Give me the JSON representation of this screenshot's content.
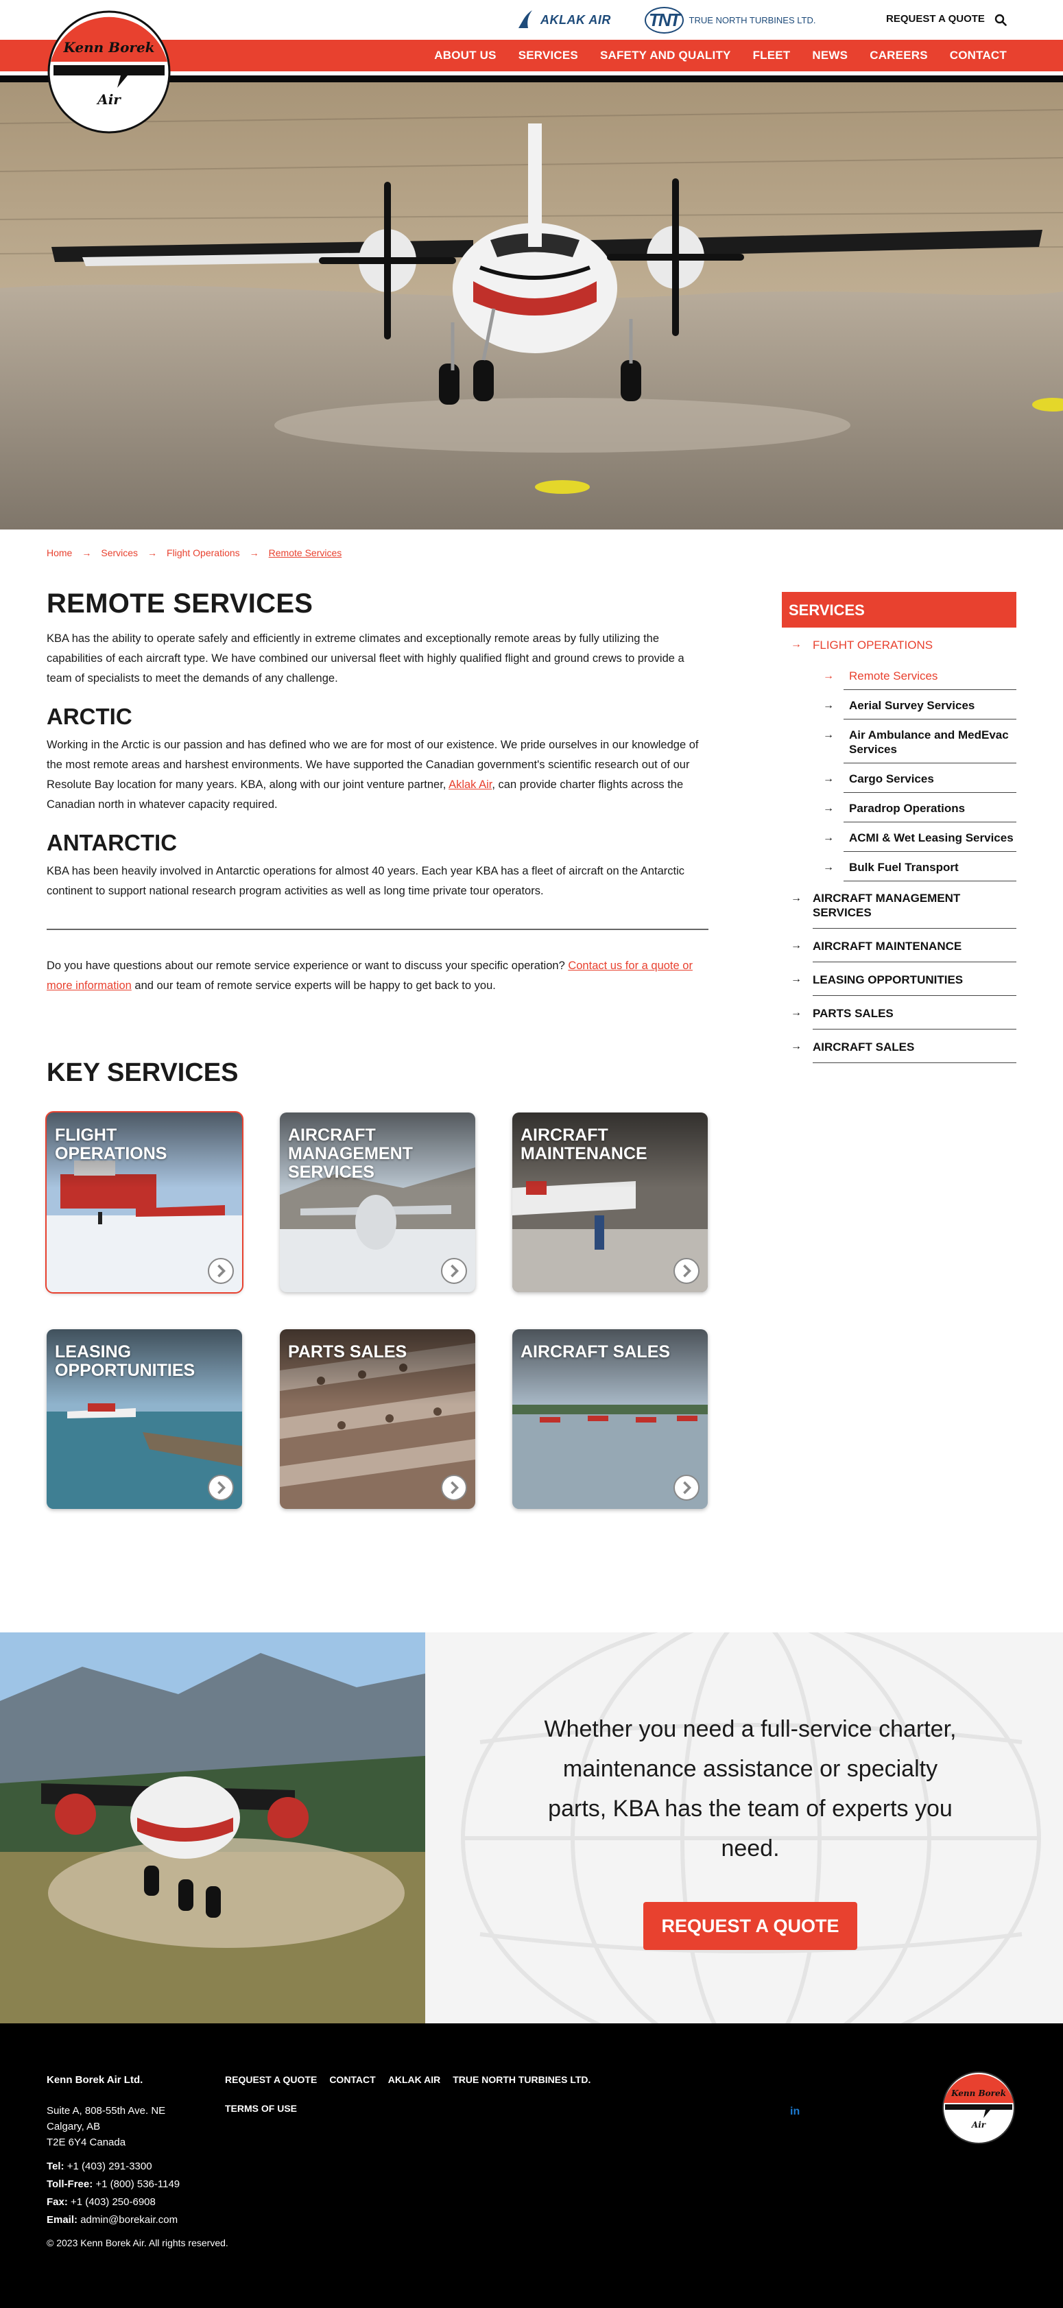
{
  "header": {
    "partners": [
      "AKLAK AIR",
      "TRUE NORTH TURBINES LTD."
    ],
    "request_quote": "REQUEST A QUOTE",
    "search_icon": "search-icon",
    "nav": [
      "ABOUT US",
      "SERVICES",
      "SAFETY AND QUALITY",
      "FLEET",
      "NEWS",
      "CAREERS",
      "CONTACT"
    ],
    "logo_text": [
      "Kenn Borek",
      "Air"
    ]
  },
  "breadcrumb": [
    "Home",
    "Services",
    "Flight Operations",
    "Remote Services"
  ],
  "main": {
    "title": "REMOTE SERVICES",
    "intro": "KBA has the ability to operate safely and efficiently in extreme climates and exceptionally remote areas by fully utilizing the capabilities of each aircraft type. We have combined our universal fleet with highly qualified flight and ground crews to provide a team of specialists to meet the demands of any challenge.",
    "arctic_title": "ARCTIC",
    "arctic_text_a": "Working in the Arctic is our passion and has defined who we are for most of our existence. We pride ourselves in our knowledge of the most remote areas and harshest environments. We have supported the Canadian government's scientific research out of our Resolute Bay location for many years. KBA, along with our joint venture partner, ",
    "arctic_link": "Aklak Air",
    "arctic_text_b": ", can provide charter flights across the Canadian north in whatever capacity required.",
    "antarctic_title": "ANTARCTIC",
    "antarctic_text": "KBA has been heavily involved in Antarctic operations for almost 40 years. Each year KBA has a fleet of aircraft on the Antarctic continent to support national research program activities as well as long time private tour operators.",
    "question_a": "Do you have questions about our remote service experience or want to discuss your specific operation? ",
    "question_link": "Contact us for a quote or more information",
    "question_b": " and our team of remote service experts will be happy to get back to you."
  },
  "sidebar": {
    "heading": "SERVICES",
    "flight_ops": "FLIGHT OPERATIONS",
    "sub": [
      "Remote Services",
      "Aerial Survey Services",
      "Air Ambulance and MedEvac Services",
      "Cargo Services",
      "Paradrop Operations",
      "ACMI & Wet Leasing Services",
      "Bulk Fuel Transport"
    ],
    "others": [
      "AIRCRAFT MANAGEMENT SERVICES",
      "AIRCRAFT MAINTENANCE",
      "LEASING OPPORTUNITIES",
      "PARTS SALES",
      "AIRCRAFT SALES"
    ]
  },
  "key_services": {
    "title": "KEY SERVICES",
    "cards": [
      "FLIGHT OPERATIONS",
      "AIRCRAFT MANAGEMENT SERVICES",
      "AIRCRAFT MAINTENANCE",
      "LEASING OPPORTUNITIES",
      "PARTS SALES",
      "AIRCRAFT SALES"
    ]
  },
  "cta": {
    "text": "Whether you need a full-service charter, maintenance assistance or specialty parts, KBA has the team of experts you need.",
    "button": "REQUEST A QUOTE"
  },
  "footer": {
    "company": "Kenn Borek Air Ltd.",
    "address": [
      "Suite A, 808-55th Ave. NE",
      "Calgary, AB",
      "T2E 6Y4 Canada"
    ],
    "tel_label": "Tel:",
    "tel": "+1 (403) 291-3300",
    "tollfree_label": "Toll-Free:",
    "tollfree": "+1 (800) 536-1149",
    "fax_label": "Fax:",
    "fax": "+1 (403) 250-6908",
    "email_label": "Email:",
    "email": "admin@borekair.com",
    "copyright": "© 2023 Kenn Borek Air. All rights reserved.",
    "links": [
      "REQUEST A QUOTE",
      "CONTACT",
      "AKLAK AIR",
      "TRUE NORTH TURBINES LTD."
    ],
    "terms": "TERMS OF USE",
    "social": "in"
  },
  "colors": {
    "brand_red": "#e8412f",
    "footer_bg": "#000000",
    "partner_blue": "#1e4b7a"
  }
}
